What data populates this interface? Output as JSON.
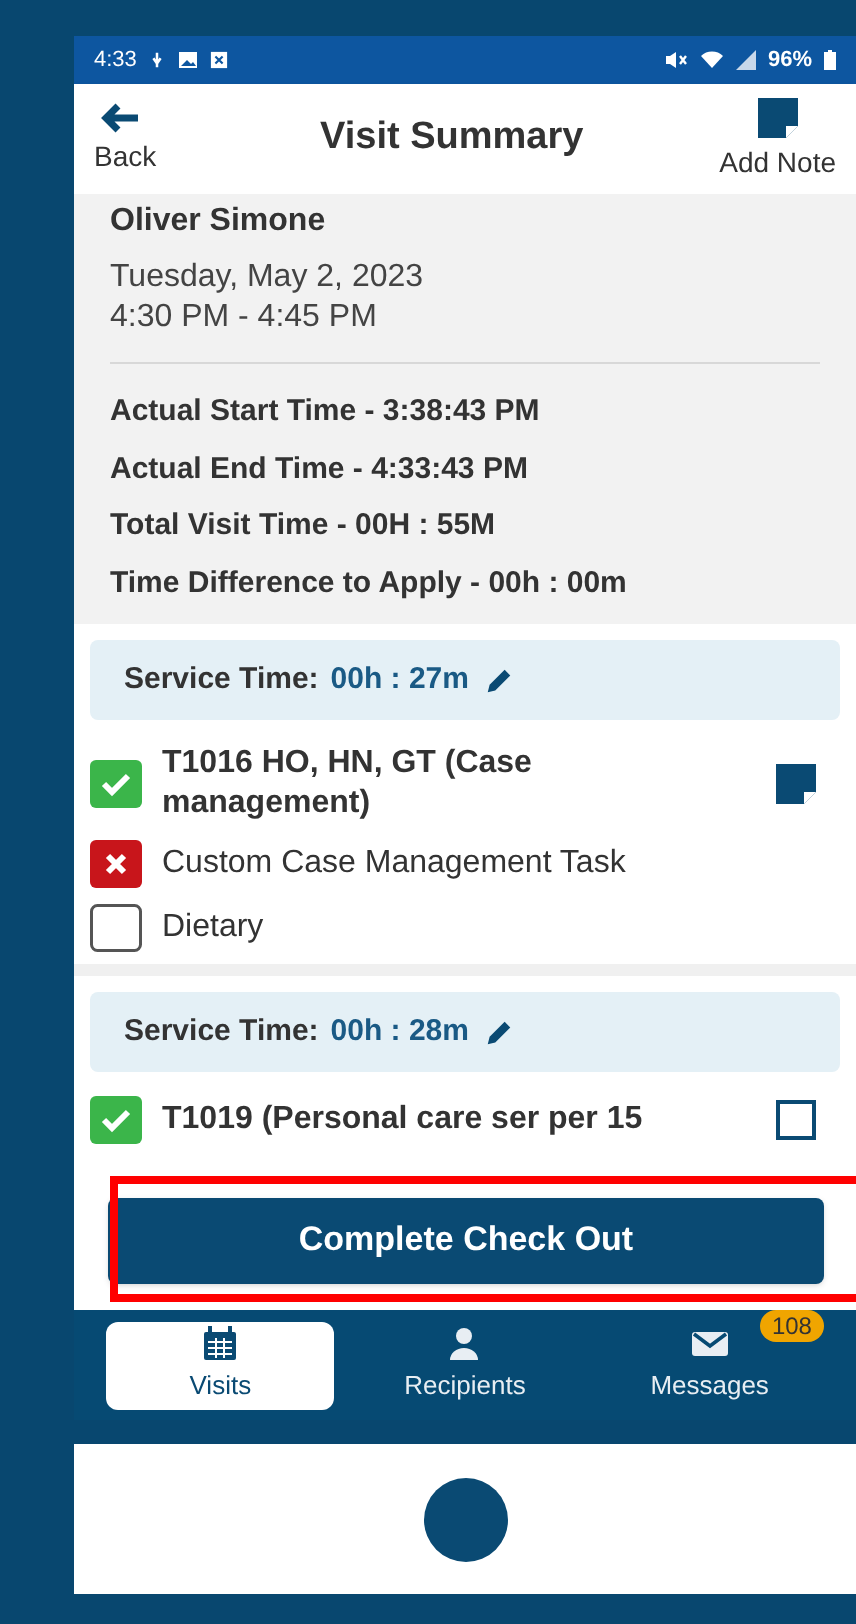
{
  "status_bar": {
    "time": "4:33",
    "battery": "96%"
  },
  "header": {
    "back_label": "Back",
    "title": "Visit Summary",
    "add_note_label": "Add Note"
  },
  "visit": {
    "recipient": "Oliver Simone",
    "date": "Tuesday, May 2, 2023",
    "time_range": "4:30 PM - 4:45 PM"
  },
  "details": [
    "Actual Start Time - 3:38:43 PM",
    "Actual End Time - 4:33:43 PM",
    "Total Visit Time - 00H : 55M",
    "Time Difference to Apply - 00h : 00m"
  ],
  "services": [
    {
      "label": "Service Time:",
      "value": "00h : 27m",
      "tasks": [
        {
          "kind": "service",
          "text": "T1016 HO, HN, GT (Case management)",
          "checked": true,
          "declined": false,
          "note_added": true
        },
        {
          "kind": "task",
          "text": "Custom Case Management Task",
          "checked": false,
          "declined": true
        },
        {
          "kind": "task",
          "text": "Dietary",
          "checked": false,
          "declined": false
        }
      ]
    },
    {
      "label": "Service Time:",
      "value": "00h : 28m",
      "tasks": [
        {
          "kind": "service",
          "text": "T1019  (Personal care ser per 15",
          "checked": true,
          "declined": false,
          "note_added": false
        }
      ]
    }
  ],
  "primary_button": {
    "label": "Complete Check Out",
    "highlighted": true
  },
  "nav": [
    {
      "label": "Visits",
      "selected": true
    },
    {
      "label": "Recipients",
      "selected": false
    },
    {
      "label": "Messages",
      "selected": false,
      "badge": "108"
    }
  ]
}
